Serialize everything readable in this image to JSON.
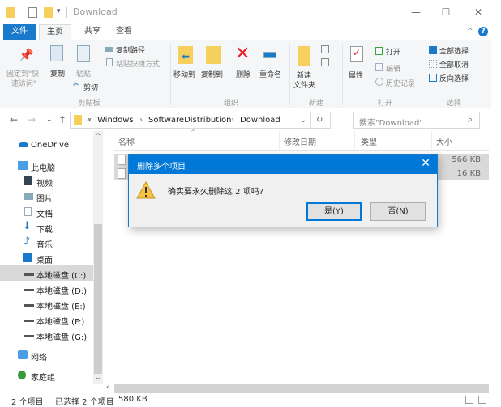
{
  "window": {
    "title": "Download",
    "controls": {
      "minimize": "—",
      "maximize": "☐",
      "close": "✕"
    }
  },
  "tabs": [
    {
      "label": "文件"
    },
    {
      "label": "主页"
    },
    {
      "label": "共享"
    },
    {
      "label": "查看"
    }
  ],
  "ribbon": {
    "clipboard": {
      "group_label": "剪贴板",
      "pin_label_1": "固定到\"快",
      "pin_label_2": "速访问\"",
      "copy": "复制",
      "paste": "粘贴",
      "copy_path": "复制路径",
      "paste_shortcut": "粘贴快捷方式",
      "cut": "剪切"
    },
    "organize": {
      "group_label": "组织",
      "move_to": "移动到",
      "copy_to": "复制到",
      "delete": "删除",
      "rename": "重命名"
    },
    "new": {
      "group_label": "新建",
      "new_folder_1": "新建",
      "new_folder_2": "文件夹"
    },
    "open": {
      "group_label": "打开",
      "properties": "属性",
      "open": "打开",
      "edit": "编辑",
      "history": "历史记录"
    },
    "select": {
      "group_label": "选择",
      "select_all": "全部选择",
      "select_none": "全部取消",
      "invert": "反向选择"
    }
  },
  "address": {
    "prefix": "«",
    "crumbs": [
      "Windows",
      "SoftwareDistribution",
      "Download"
    ],
    "separator": "›",
    "search_placeholder": "搜索\"Download\""
  },
  "sidebar": {
    "items": [
      {
        "label": "OneDrive"
      },
      {
        "label": "此电脑"
      },
      {
        "label": "视频"
      },
      {
        "label": "图片"
      },
      {
        "label": "文档"
      },
      {
        "label": "下载"
      },
      {
        "label": "音乐"
      },
      {
        "label": "桌面"
      },
      {
        "label": "本地磁盘 (C:)"
      },
      {
        "label": "本地磁盘 (D:)"
      },
      {
        "label": "本地磁盘 (E:)"
      },
      {
        "label": "本地磁盘 (F:)"
      },
      {
        "label": "本地磁盘 (G:)"
      },
      {
        "label": "网络"
      },
      {
        "label": "家庭组"
      }
    ]
  },
  "columns": [
    "名称",
    "修改日期",
    "类型",
    "大小"
  ],
  "files": [
    {
      "size": "566 KB"
    },
    {
      "size": "16 KB"
    }
  ],
  "dialog": {
    "title": "删除多个项目",
    "message": "确实要永久删除这 2 项吗?",
    "yes": "是(Y)",
    "no": "否(N)",
    "close": "✕"
  },
  "status": {
    "count": "2 个项目",
    "selected": "已选择 2 个项目",
    "size": "580 KB"
  }
}
